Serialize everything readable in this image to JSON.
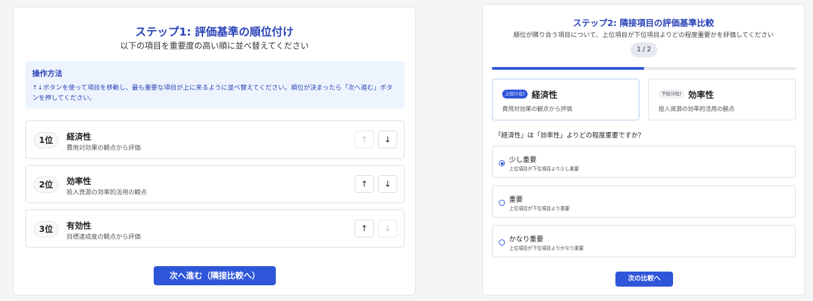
{
  "step1": {
    "title": "ステップ1: 評価基準の順位付け",
    "subtitle": "以下の項目を重要度の高い順に並べ替えてください",
    "help_title": "操作方法",
    "help_text": "↑↓ボタンを使って項目を移動し、最も重要な項目が上に来るように並べ替えてください。順位が決まったら「次へ進む」ボタンを押してください。",
    "up_icon": "arrow-up-icon",
    "down_icon": "arrow-down-icon",
    "items": [
      {
        "rank": "1位",
        "name": "経済性",
        "desc": "費用対効果の観点から評価",
        "up_disabled": true,
        "down_disabled": false
      },
      {
        "rank": "2位",
        "name": "効率性",
        "desc": "投入資源の効率的活用の観点",
        "up_disabled": false,
        "down_disabled": false
      },
      {
        "rank": "3位",
        "name": "有効性",
        "desc": "目標達成度の観点から評価",
        "up_disabled": false,
        "down_disabled": true
      }
    ],
    "next_label": "次へ進む（隣接比較へ）"
  },
  "step2": {
    "title": "ステップ2: 隣接項目の評価基準比較",
    "subtitle": "順位が隣り合う項目について、上位項目が下位項目よりどの程度重要かを評価してください",
    "counter": "1 / 2",
    "progress_fraction": 0.5,
    "upper": {
      "tag": "上位(1位)",
      "name": "経済性",
      "desc": "費用対効果の観点から評価"
    },
    "lower": {
      "tag": "下位(2位)",
      "name": "効率性",
      "desc": "投入資源の効率的活用の観点"
    },
    "question": "「経済性」は「効率性」よりどの程度重要ですか？",
    "options": [
      {
        "label": "少し重要",
        "sub": "上位項目が下位項目より少し重要",
        "checked": true
      },
      {
        "label": "重要",
        "sub": "上位項目が下位項目より重要",
        "checked": false
      },
      {
        "label": "かなり重要",
        "sub": "上位項目が下位項目よりかなり重要",
        "checked": false
      }
    ],
    "next_label": "次の比較へ"
  },
  "colors": {
    "accent": "#2f56d9",
    "title": "#2a43b8",
    "help_bg": "#eef4fd"
  }
}
